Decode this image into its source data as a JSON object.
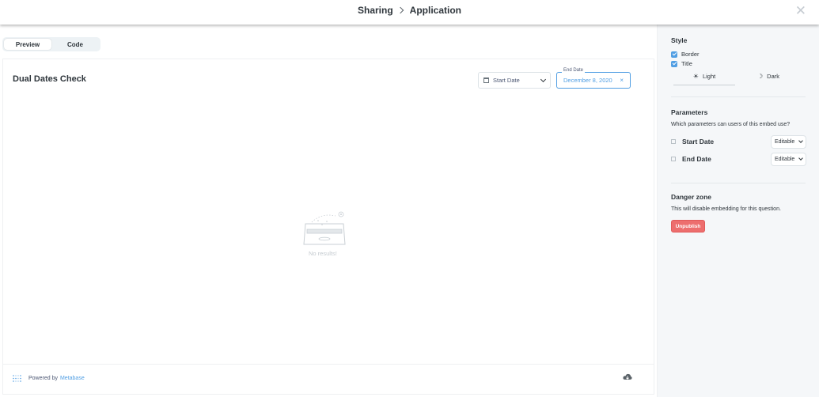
{
  "header": {
    "crumb_parent": "Sharing",
    "crumb_current": "Application",
    "close_icon": "close-icon"
  },
  "tabs": [
    {
      "label": "Preview",
      "active": true
    },
    {
      "label": "Code",
      "active": false
    }
  ],
  "card": {
    "title": "Dual Dates Check",
    "start_filter_placeholder": "Start Date",
    "end_filter_legend": "End Date",
    "end_filter_value": "December 8, 2020",
    "end_filter_clear": "×",
    "empty_text": "No results!",
    "footer_text": "Powered by",
    "footer_link": "Metabase"
  },
  "sidebar": {
    "style_title": "Style",
    "border_label": "Border",
    "border_checked": true,
    "title_label": "Title",
    "title_checked": true,
    "theme_light": "Light",
    "theme_dark": "Dark",
    "params_title": "Parameters",
    "params_desc": "Which parameters can users of this embed use?",
    "params": [
      {
        "name": "Start Date",
        "mode": "Editable"
      },
      {
        "name": "End Date",
        "mode": "Editable"
      }
    ],
    "danger_title": "Danger zone",
    "danger_desc": "This will disable embedding for this question.",
    "unpublish_label": "Unpublish"
  },
  "colors": {
    "brand": "#509ee3",
    "danger": "#ed6e6e",
    "sidebar_bg": "#f5f7f9"
  }
}
